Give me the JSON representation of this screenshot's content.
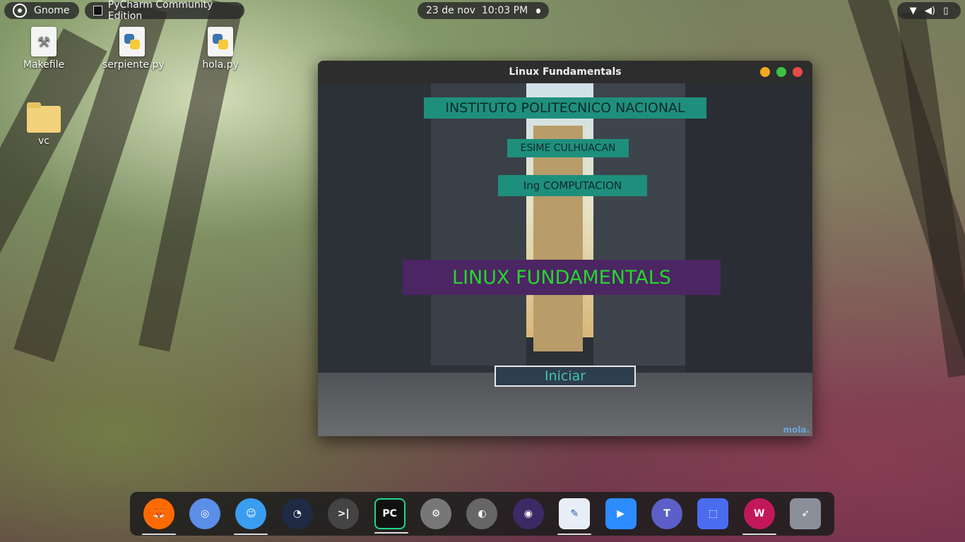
{
  "topbar": {
    "activities_label": "Gnome",
    "app_label": "PyCharm Community Edition",
    "clock": "23 de nov  10:03 PM",
    "tray": [
      "wifi-icon",
      "volume-icon",
      "battery-icon"
    ]
  },
  "desktop": {
    "icons": [
      {
        "label": "Makefile",
        "icon": "hammer-icon"
      },
      {
        "label": "serpiente.py",
        "icon": "python-file-icon"
      },
      {
        "label": "hola.py",
        "icon": "python-file-icon"
      },
      {
        "label": "vc",
        "icon": "folder-icon"
      }
    ]
  },
  "window": {
    "title": "Linux Fundamentals",
    "app": {
      "institute": "INSTITUTO POLITECNICO NACIONAL",
      "school": "ESIME CULHUACAN",
      "career": "Ing COMPUTACION",
      "course": "LINUX FUNDAMENTALS",
      "start_button": "Iniciar",
      "watermark": "mola."
    }
  },
  "dock": {
    "items": [
      {
        "name": "firefox",
        "label": "Firefox",
        "color": "#ff6a00",
        "running": true
      },
      {
        "name": "chromium",
        "label": "Chromium",
        "color": "#5b8ee6",
        "running": false
      },
      {
        "name": "finder",
        "label": "Files",
        "color": "#3a9df0",
        "running": true
      },
      {
        "name": "speedometer",
        "label": "Speed",
        "color": "#1f2a44",
        "running": false
      },
      {
        "name": "terminal",
        "label": ">|",
        "color": "#444444",
        "running": false
      },
      {
        "name": "pycharm",
        "label": "PC",
        "color": "#111111",
        "running": true
      },
      {
        "name": "settings",
        "label": "Settings",
        "color": "#777777",
        "running": false
      },
      {
        "name": "toggle",
        "label": "Tweaks",
        "color": "#666666",
        "running": false
      },
      {
        "name": "camera",
        "label": "Camera",
        "color": "#3b2a66",
        "running": false
      },
      {
        "name": "text-editor",
        "label": "Writer",
        "color": "#e8eef7",
        "running": true
      },
      {
        "name": "zoom",
        "label": "Zoom",
        "color": "#2d8cff",
        "running": false
      },
      {
        "name": "teams",
        "label": "Teams",
        "color": "#5b5fc7",
        "running": false
      },
      {
        "name": "screenshot",
        "label": "Screenshot",
        "color": "#4a6cf0",
        "running": false
      },
      {
        "name": "app-w",
        "label": "W",
        "color": "#c2185b",
        "running": true
      },
      {
        "name": "launcher",
        "label": "Launcher",
        "color": "#8a8f99",
        "running": false
      }
    ]
  }
}
